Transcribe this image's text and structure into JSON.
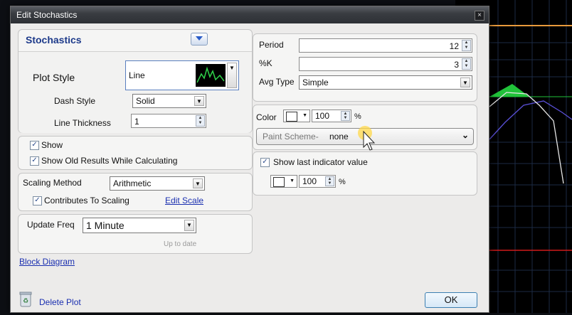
{
  "window": {
    "title": "Edit Stochastics",
    "close_glyph": "×"
  },
  "plot": {
    "header": "Stochastics",
    "plot_style_label": "Plot Style",
    "plot_style_value": "Line",
    "dash_style_label": "Dash Style",
    "dash_style_value": "Solid",
    "line_thickness_label": "Line Thickness",
    "line_thickness_value": "1"
  },
  "options": {
    "show_label": "Show",
    "show_checked": true,
    "show_old_label": "Show Old Results While Calculating",
    "show_old_checked": true
  },
  "scaling": {
    "method_label": "Scaling Method",
    "method_value": "Arithmetic",
    "contributes_label": "Contributes To Scaling",
    "contributes_checked": true,
    "edit_scale_link": "Edit Scale"
  },
  "update": {
    "freq_label": "Update Freq",
    "freq_value": "1 Minute",
    "status": "Up to date"
  },
  "links": {
    "block_diagram": "Block Diagram",
    "delete_plot": "Delete Plot"
  },
  "params": {
    "period_label": "Period",
    "period_value": "12",
    "k_label": "%K",
    "k_value": "3",
    "avg_type_label": "Avg Type",
    "avg_type_value": "Simple"
  },
  "color": {
    "label": "Color",
    "opacity": "100",
    "percent": "%",
    "paint_scheme_label": "Paint Scheme-",
    "paint_scheme_value": "none"
  },
  "last_indicator": {
    "label": "Show last indicator value",
    "checked": true,
    "opacity": "100",
    "percent": "%"
  },
  "buttons": {
    "ok": "OK"
  },
  "icons": {
    "collapse": "collapse-arrow-icon",
    "recycle": "recycle-bin-icon",
    "cursor": "mouse-pointer-icon",
    "preview": "line-preview-icon"
  },
  "colors": {
    "header_blue": "#1d3a8a",
    "link_blue": "#1a2fb0",
    "chart_orange": "#e89a3c",
    "chart_green": "#21c33a",
    "chart_purple": "#5a50d8",
    "chart_red": "#d11a1a"
  }
}
